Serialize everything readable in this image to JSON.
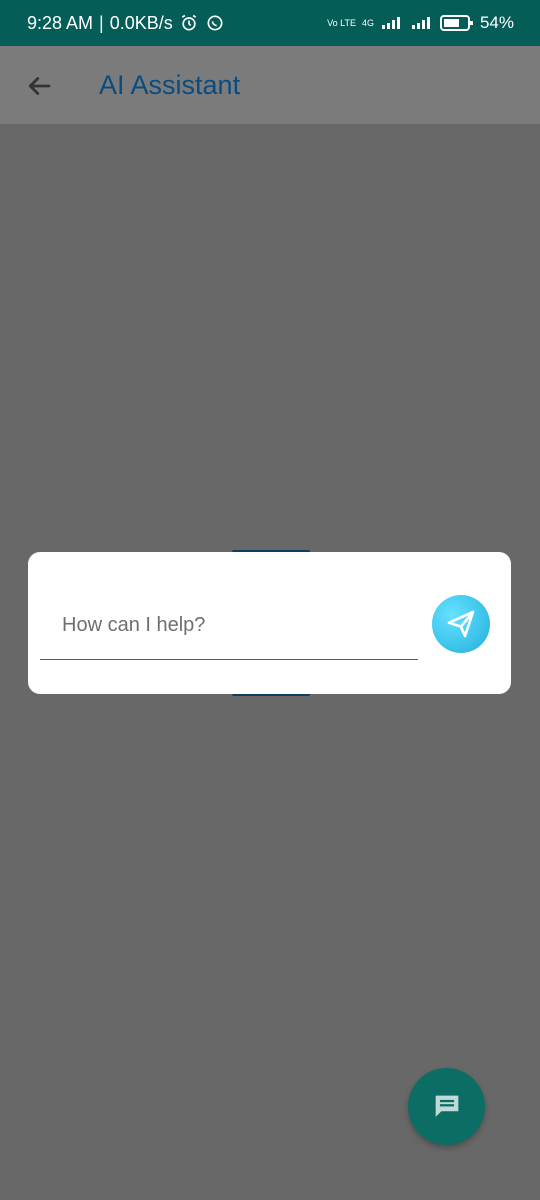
{
  "status_bar": {
    "time": "9:28 AM",
    "network_speed": "0.0KB/s",
    "network_type": "4G",
    "volte_badge": "Vo LTE",
    "battery": "54%",
    "icons": [
      "alarm-icon",
      "whatsapp-icon",
      "signal-icon",
      "battery-icon"
    ]
  },
  "app_bar": {
    "title": "AI Assistant",
    "back_icon": "arrow-back-icon"
  },
  "dialog": {
    "input_placeholder": "How can I help?",
    "input_value": "",
    "send_icon": "send-paper-plane-icon"
  },
  "fab": {
    "icon": "chat-icon"
  },
  "colors": {
    "status_bar": "#045d56",
    "title": "#0b4c80",
    "scrim": "#686868",
    "send_button": "#3cc4ea",
    "fab": "#0b6d64"
  }
}
